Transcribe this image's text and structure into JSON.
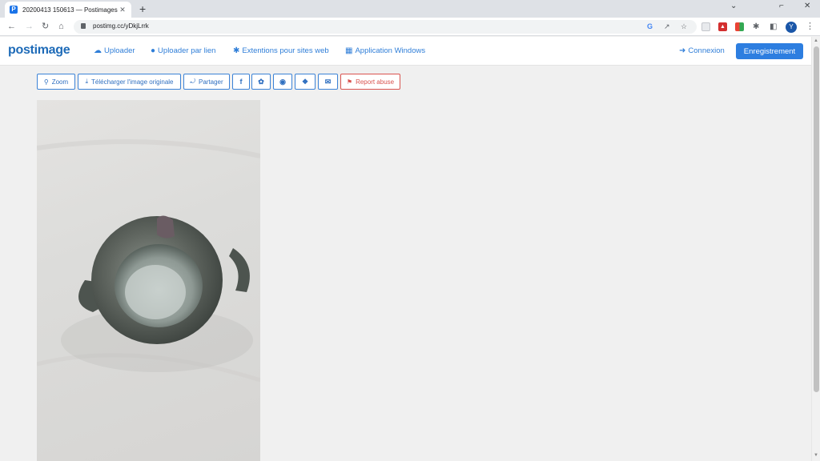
{
  "browser": {
    "tab_title": "20200413 150613 — Postimages",
    "tab_close": "✕",
    "new_tab": "+",
    "url": "postimg.cc/yDkjLrrk",
    "controls": {
      "minimize": "⌄",
      "restore": "⌐",
      "close": "✕"
    }
  },
  "site": {
    "logo": "postimage",
    "nav": {
      "upload": "Uploader",
      "upload_by_link": "Uploader par lien",
      "extensions": "Extentions pour sites web",
      "windows_app": "Application Windows"
    },
    "login": "Connexion",
    "register": "Enregistrement"
  },
  "share_bar": {
    "zoom": "Zoom",
    "download": "Télécharger l'image originale",
    "share": "Partager",
    "facebook": "f",
    "report": "Report abuse"
  },
  "colors": {
    "accent": "#2d7ee0",
    "link": "#2f7ed8",
    "report": "#d9534f"
  }
}
